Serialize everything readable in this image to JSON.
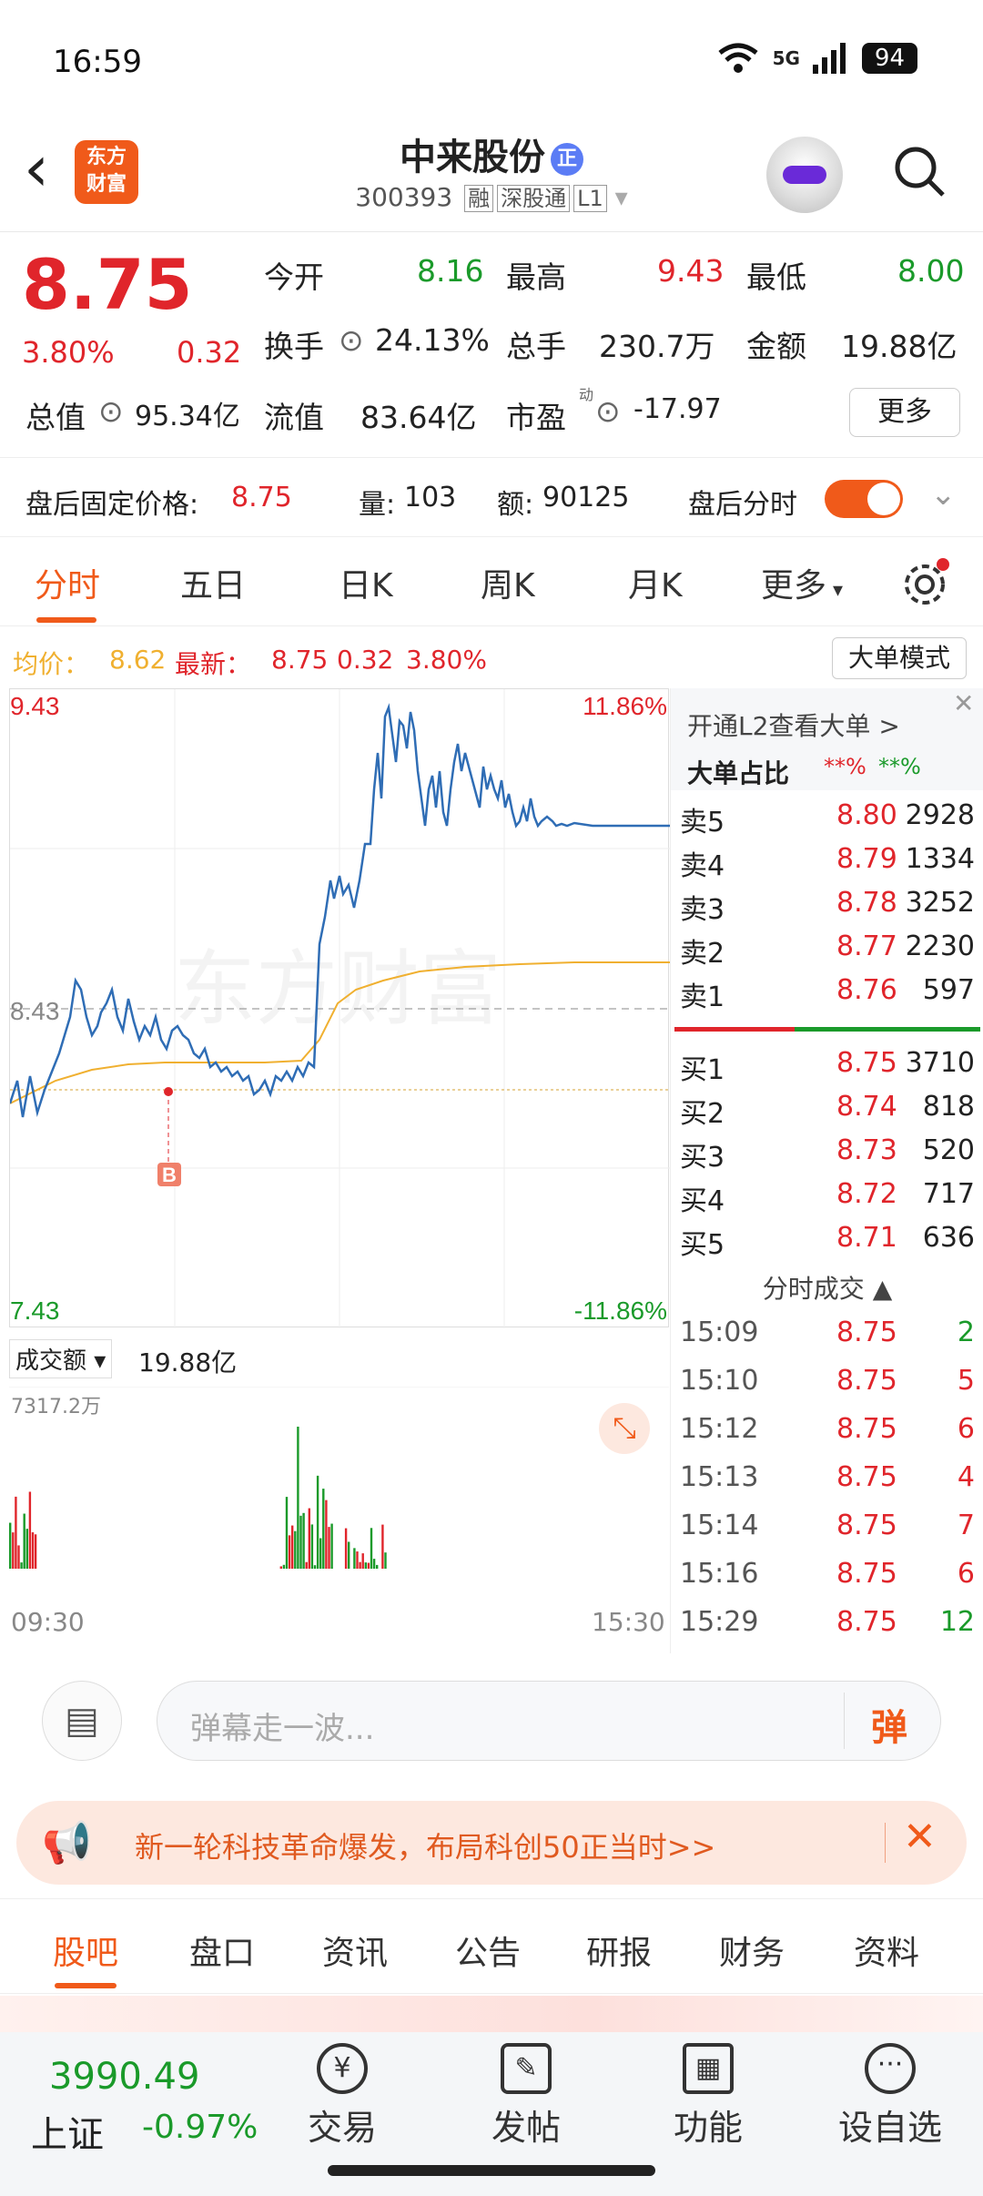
{
  "status_bar": {
    "time": "16:59",
    "network": "5G",
    "battery": "94"
  },
  "header": {
    "logo_text": "东方\n财富",
    "stock_name": "中来股份",
    "name_badge": "正",
    "stock_code": "300393",
    "tags": [
      "融",
      "深股通",
      "L1"
    ]
  },
  "quote": {
    "price": "8.75",
    "change_pct": "3.80%",
    "change": "0.32",
    "open_label": "今开",
    "open": "8.16",
    "high_label": "最高",
    "high": "9.43",
    "low_label": "最低",
    "low": "8.00",
    "turnover_label": "换手",
    "turnover": "24.13%",
    "volume_label": "总手",
    "volume": "230.7万",
    "amount_label": "金额",
    "amount": "19.88亿",
    "mktcap_label": "总值",
    "mktcap": "95.34亿",
    "float_label": "流值",
    "float": "83.64亿",
    "pe_label": "市盈",
    "pe_sup": "动",
    "pe": "-17.97",
    "more_button": "更多"
  },
  "after_hours": {
    "label": "盘后固定价格:",
    "price": "8.75",
    "vol_label": "量:",
    "vol": "103",
    "amt_label": "额:",
    "amt": "90125",
    "toggle_label": "盘后分时"
  },
  "chart_tabs": [
    "分时",
    "五日",
    "日K",
    "周K",
    "月K",
    "更多"
  ],
  "avg_line": {
    "avg_label": "均价：",
    "avg": "8.62",
    "last_label": "最新：",
    "last": "8.75",
    "chg": "0.32",
    "pct": "3.80%",
    "big_order_button": "大单模式"
  },
  "chart_labels": {
    "top_left": "9.43",
    "top_right": "11.86%",
    "mid": "8.43",
    "bottom_left": "7.43",
    "bottom_right": "-11.86%",
    "marker": "B",
    "watermark": "东方财富"
  },
  "volume_panel": {
    "selector": "成交额",
    "total": "19.88亿",
    "max_label": "7317.2万",
    "start_time": "09:30",
    "end_time": "15:30"
  },
  "depth": {
    "l2_link": "开通L2查看大单 >",
    "big_label": "大单占比",
    "big_red": "**%",
    "big_green": "**%",
    "asks": [
      {
        "label": "卖5",
        "price": "8.80",
        "vol": "2928"
      },
      {
        "label": "卖4",
        "price": "8.79",
        "vol": "1334"
      },
      {
        "label": "卖3",
        "price": "8.78",
        "vol": "3252"
      },
      {
        "label": "卖2",
        "price": "8.77",
        "vol": "2230"
      },
      {
        "label": "卖1",
        "price": "8.76",
        "vol": "597"
      }
    ],
    "bids": [
      {
        "label": "买1",
        "price": "8.75",
        "vol": "3710"
      },
      {
        "label": "买2",
        "price": "8.74",
        "vol": "818"
      },
      {
        "label": "买3",
        "price": "8.73",
        "vol": "520"
      },
      {
        "label": "买4",
        "price": "8.72",
        "vol": "717"
      },
      {
        "label": "买5",
        "price": "8.71",
        "vol": "636"
      }
    ],
    "trades_title": "分时成交",
    "trades": [
      {
        "time": "15:09",
        "price": "8.75",
        "vol": "2"
      },
      {
        "time": "15:10",
        "price": "8.75",
        "vol": "5"
      },
      {
        "time": "15:12",
        "price": "8.75",
        "vol": "6"
      },
      {
        "time": "15:13",
        "price": "8.75",
        "vol": "4"
      },
      {
        "time": "15:14",
        "price": "8.75",
        "vol": "7"
      },
      {
        "time": "15:16",
        "price": "8.75",
        "vol": "6"
      },
      {
        "time": "15:29",
        "price": "8.75",
        "vol": "12"
      }
    ]
  },
  "danmu": {
    "placeholder": "弹幕走一波...",
    "send_label": "弹"
  },
  "banner": {
    "text": "新一轮科技革命爆发，布局科创50正当时>>"
  },
  "bottom_tabs": [
    "股吧",
    "盘口",
    "资讯",
    "公告",
    "研报",
    "财务",
    "资料"
  ],
  "bottom_nav": {
    "index_value": "3990.49",
    "index_name": "上证",
    "index_change": "-0.97%",
    "items": [
      "交易",
      "发帖",
      "功能",
      "设自选"
    ]
  },
  "colors": {
    "up": "#e0252b",
    "down": "#1a9a2a",
    "accent": "#f05a1a",
    "price_line": "#2f6db5",
    "avg_line": "#f0b030"
  }
}
